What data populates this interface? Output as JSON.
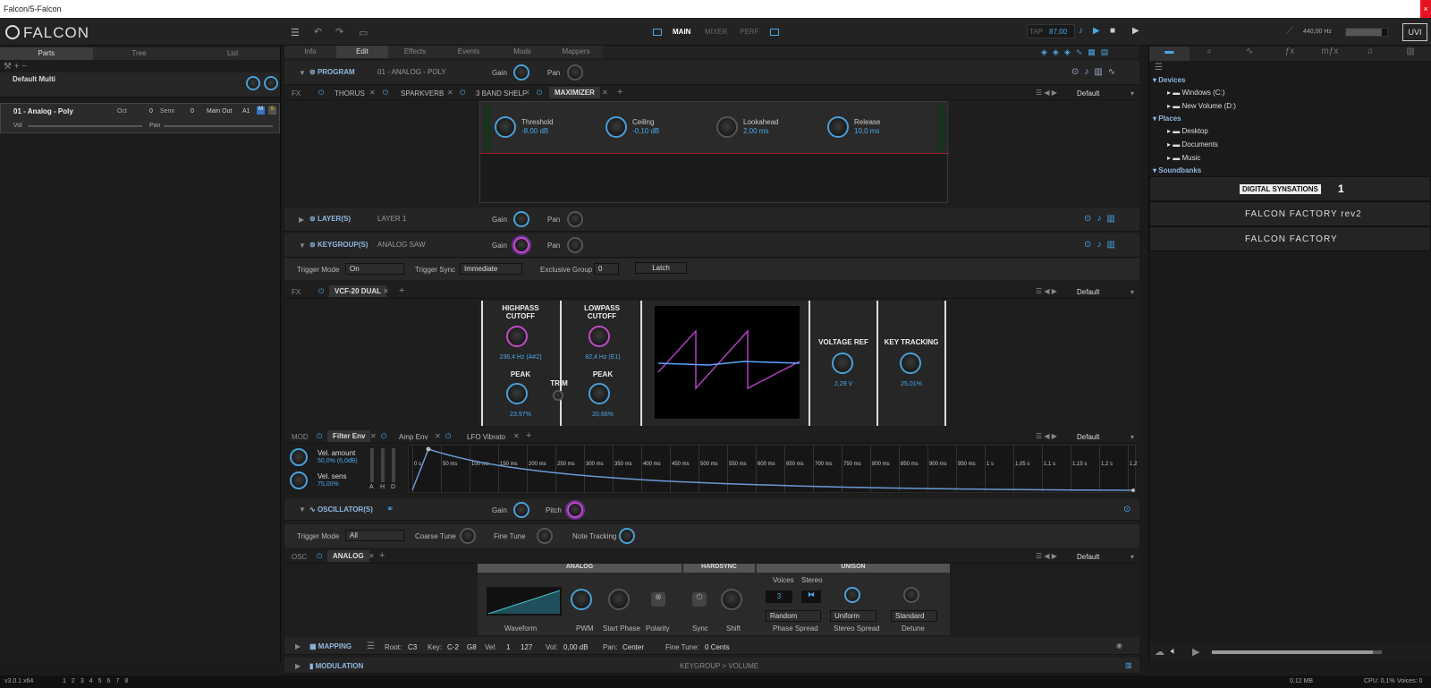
{
  "window": {
    "title": "Falcon/5-Falcon",
    "close": "×"
  },
  "app": {
    "logo": "FALCON"
  },
  "top": {
    "views": [
      "MAIN",
      "MIXER",
      "PERF"
    ],
    "tap": "TAP",
    "tempo": "87,00",
    "tuning": "440,00 Hz",
    "uvi": "UVI"
  },
  "left": {
    "tabs": [
      "Parts",
      "Tree",
      "List"
    ],
    "multi": "Default Multi",
    "part": {
      "name": "01 - Analog - Poly",
      "oct_label": "Oct",
      "oct": "0",
      "semi_label": "Semi",
      "semi": "0",
      "out": "Main Out",
      "a1": "A1",
      "m": "M",
      "s": "S",
      "vol": "Vol",
      "pan": "Pan"
    }
  },
  "main": {
    "tabs": [
      "Info",
      "Edit",
      "Effects",
      "Events",
      "Mods",
      "Mappers"
    ],
    "program": {
      "label": "PROGRAM",
      "name": "01 - ANALOG - POLY",
      "gain": "Gain",
      "pan": "Pan"
    },
    "fx": {
      "label": "FX",
      "items": [
        "THORUS",
        "SPARKVERB",
        "3 BAND SHELF",
        "MAXIMIZER"
      ],
      "preset": "Default"
    },
    "maximizer": [
      {
        "name": "Threshold",
        "val": "-8,00 dB"
      },
      {
        "name": "Ceiling",
        "val": "-0,10 dB"
      },
      {
        "name": "Lookahead",
        "val": "2,00 ms"
      },
      {
        "name": "Release",
        "val": "10,0 ms"
      }
    ],
    "layer": {
      "label": "LAYER(S)",
      "name": "LAYER 1",
      "gain": "Gain",
      "pan": "Pan"
    },
    "keygroup": {
      "label": "KEYGROUP(S)",
      "name": "ANALOG SAW",
      "gain": "Gain",
      "pan": "Pan"
    },
    "trigger": {
      "mode_label": "Trigger Mode",
      "mode": "On",
      "sync_label": "Trigger Sync",
      "sync": "Immediate",
      "excl_label": "Exclusive Group",
      "excl": "0",
      "latch": "Latch"
    },
    "fx2": {
      "label": "FX",
      "item": "VCF-20 DUAL",
      "preset": "Default"
    },
    "vcf": {
      "hp": "HIGHPASS CUTOFF",
      "hp_val": "236,4 Hz (A#2)",
      "lp": "LOWPASS CUTOFF",
      "lp_val": "82,4 Hz (E1)",
      "peak": "PEAK",
      "peak1": "23,97%",
      "trim": "TRIM",
      "peak2": "20,66%",
      "vref": "VOLTAGE REF",
      "vref_val": "2,29 V",
      "kt": "KEY TRACKING",
      "kt_val": "25,01%"
    },
    "mod": {
      "label": "MOD",
      "items": [
        "Filter Env",
        "Amp Env",
        "LFO Vibrato"
      ],
      "preset": "Default",
      "vel_amt": "Vel. amount",
      "vel_amt_val": "50,0% (6,0dB)",
      "vel_sens": "Vel. sens",
      "vel_sens_val": "75,00%",
      "ahd": [
        "A",
        "H",
        "D"
      ],
      "times": [
        "0 s",
        "50 ms",
        "100 ms",
        "150 ms",
        "200 ms",
        "250 ms",
        "300 ms",
        "350 ms",
        "400 ms",
        "450 ms",
        "500 ms",
        "550 ms",
        "600 ms",
        "650 ms",
        "700 ms",
        "750 ms",
        "800 ms",
        "850 ms",
        "900 ms",
        "950 ms",
        "1 s",
        "1,05 s",
        "1,1 s",
        "1,15 s",
        "1,2 s",
        "1,2"
      ]
    },
    "osc": {
      "label": "OSCILLATOR(S)",
      "gain": "Gain",
      "pitch": "Pitch",
      "trig_label": "Trigger Mode",
      "trig": "All",
      "coarse": "Coarse Tune",
      "fine": "Fine Tune",
      "note": "Note Tracking"
    },
    "osc2": {
      "label": "OSC",
      "item": "ANALOG",
      "preset": "Default"
    },
    "analog": {
      "head": "ANALOG",
      "hardsync": "HARDSYNC",
      "unison": "UNISON",
      "waveform": "Waveform",
      "pwm": "PWM",
      "start": "Start Phase",
      "polarity": "Polarity",
      "sync": "Sync",
      "shift": "Shift",
      "voices": "Voices",
      "voices_val": "3",
      "stereo": "Stereo",
      "random": "Random",
      "phase_spread": "Phase Spread",
      "uniform": "Uniform",
      "stereo_spread": "Stereo Spread",
      "standard": "Standard",
      "detune": "Detune"
    },
    "mapping": {
      "label": "MAPPING",
      "root_l": "Root:",
      "root": "C3",
      "key_l": "Key:",
      "key1": "C-2",
      "key2": "G8",
      "vel_l": "Vel:",
      "vel1": "1",
      "vel2": "127",
      "vol_l": "Vol:",
      "vol": "0,00 dB",
      "pan_l": "Pan:",
      "pan": "Center",
      "ft_l": "Fine Tune:",
      "ft": "0 Cents"
    },
    "modulation": {
      "label": "MODULATION",
      "path": "KEYGROUP > VOLUME"
    }
  },
  "browser": {
    "devices": "Devices",
    "drives": [
      "Windows (C:)",
      "New Volume (D:)"
    ],
    "places": "Places",
    "folders": [
      "Desktop",
      "Documents",
      "Music"
    ],
    "soundbanks": "Soundbanks",
    "banks": [
      "DIGITAL SYNSATIONS",
      "FALCON FACTORY rev2",
      "FALCON FACTORY"
    ],
    "ds_num": "1"
  },
  "status": {
    "version": "v3.0.1 x64",
    "pages": [
      "1",
      "2",
      "3",
      "4",
      "5",
      "6",
      "7",
      "8"
    ],
    "mem": "0,12 MB",
    "cpu": "CPU: 0,1%",
    "voices": "Voices: 0"
  },
  "colors": {
    "accent": "#4aa8e8",
    "pink": "#c04cc6",
    "header": "#8fb8e0"
  }
}
